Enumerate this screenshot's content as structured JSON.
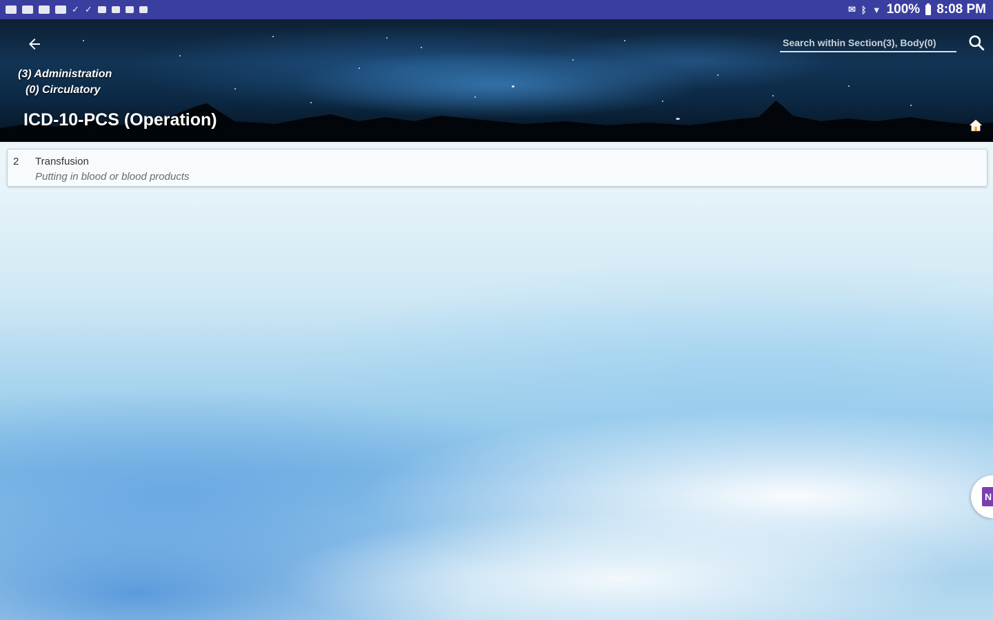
{
  "status_bar": {
    "battery": "100%",
    "time": "8:08 PM"
  },
  "header": {
    "breadcrumb": [
      "(3) Administration",
      "(0) Circulatory"
    ],
    "title": "ICD-10-PCS (Operation)",
    "search": {
      "placeholder": "Search within Section(3), Body(0)"
    }
  },
  "results": [
    {
      "code": "2",
      "title": "Transfusion",
      "description": "Putting in blood or blood products"
    }
  ],
  "floating_bubble": {
    "label": "N"
  },
  "colors": {
    "status_bar": "#3a3f9f",
    "header_dark": "#0c2944",
    "card_bg": "#f7fbfd",
    "bubble_accent": "#7b3fb0"
  }
}
